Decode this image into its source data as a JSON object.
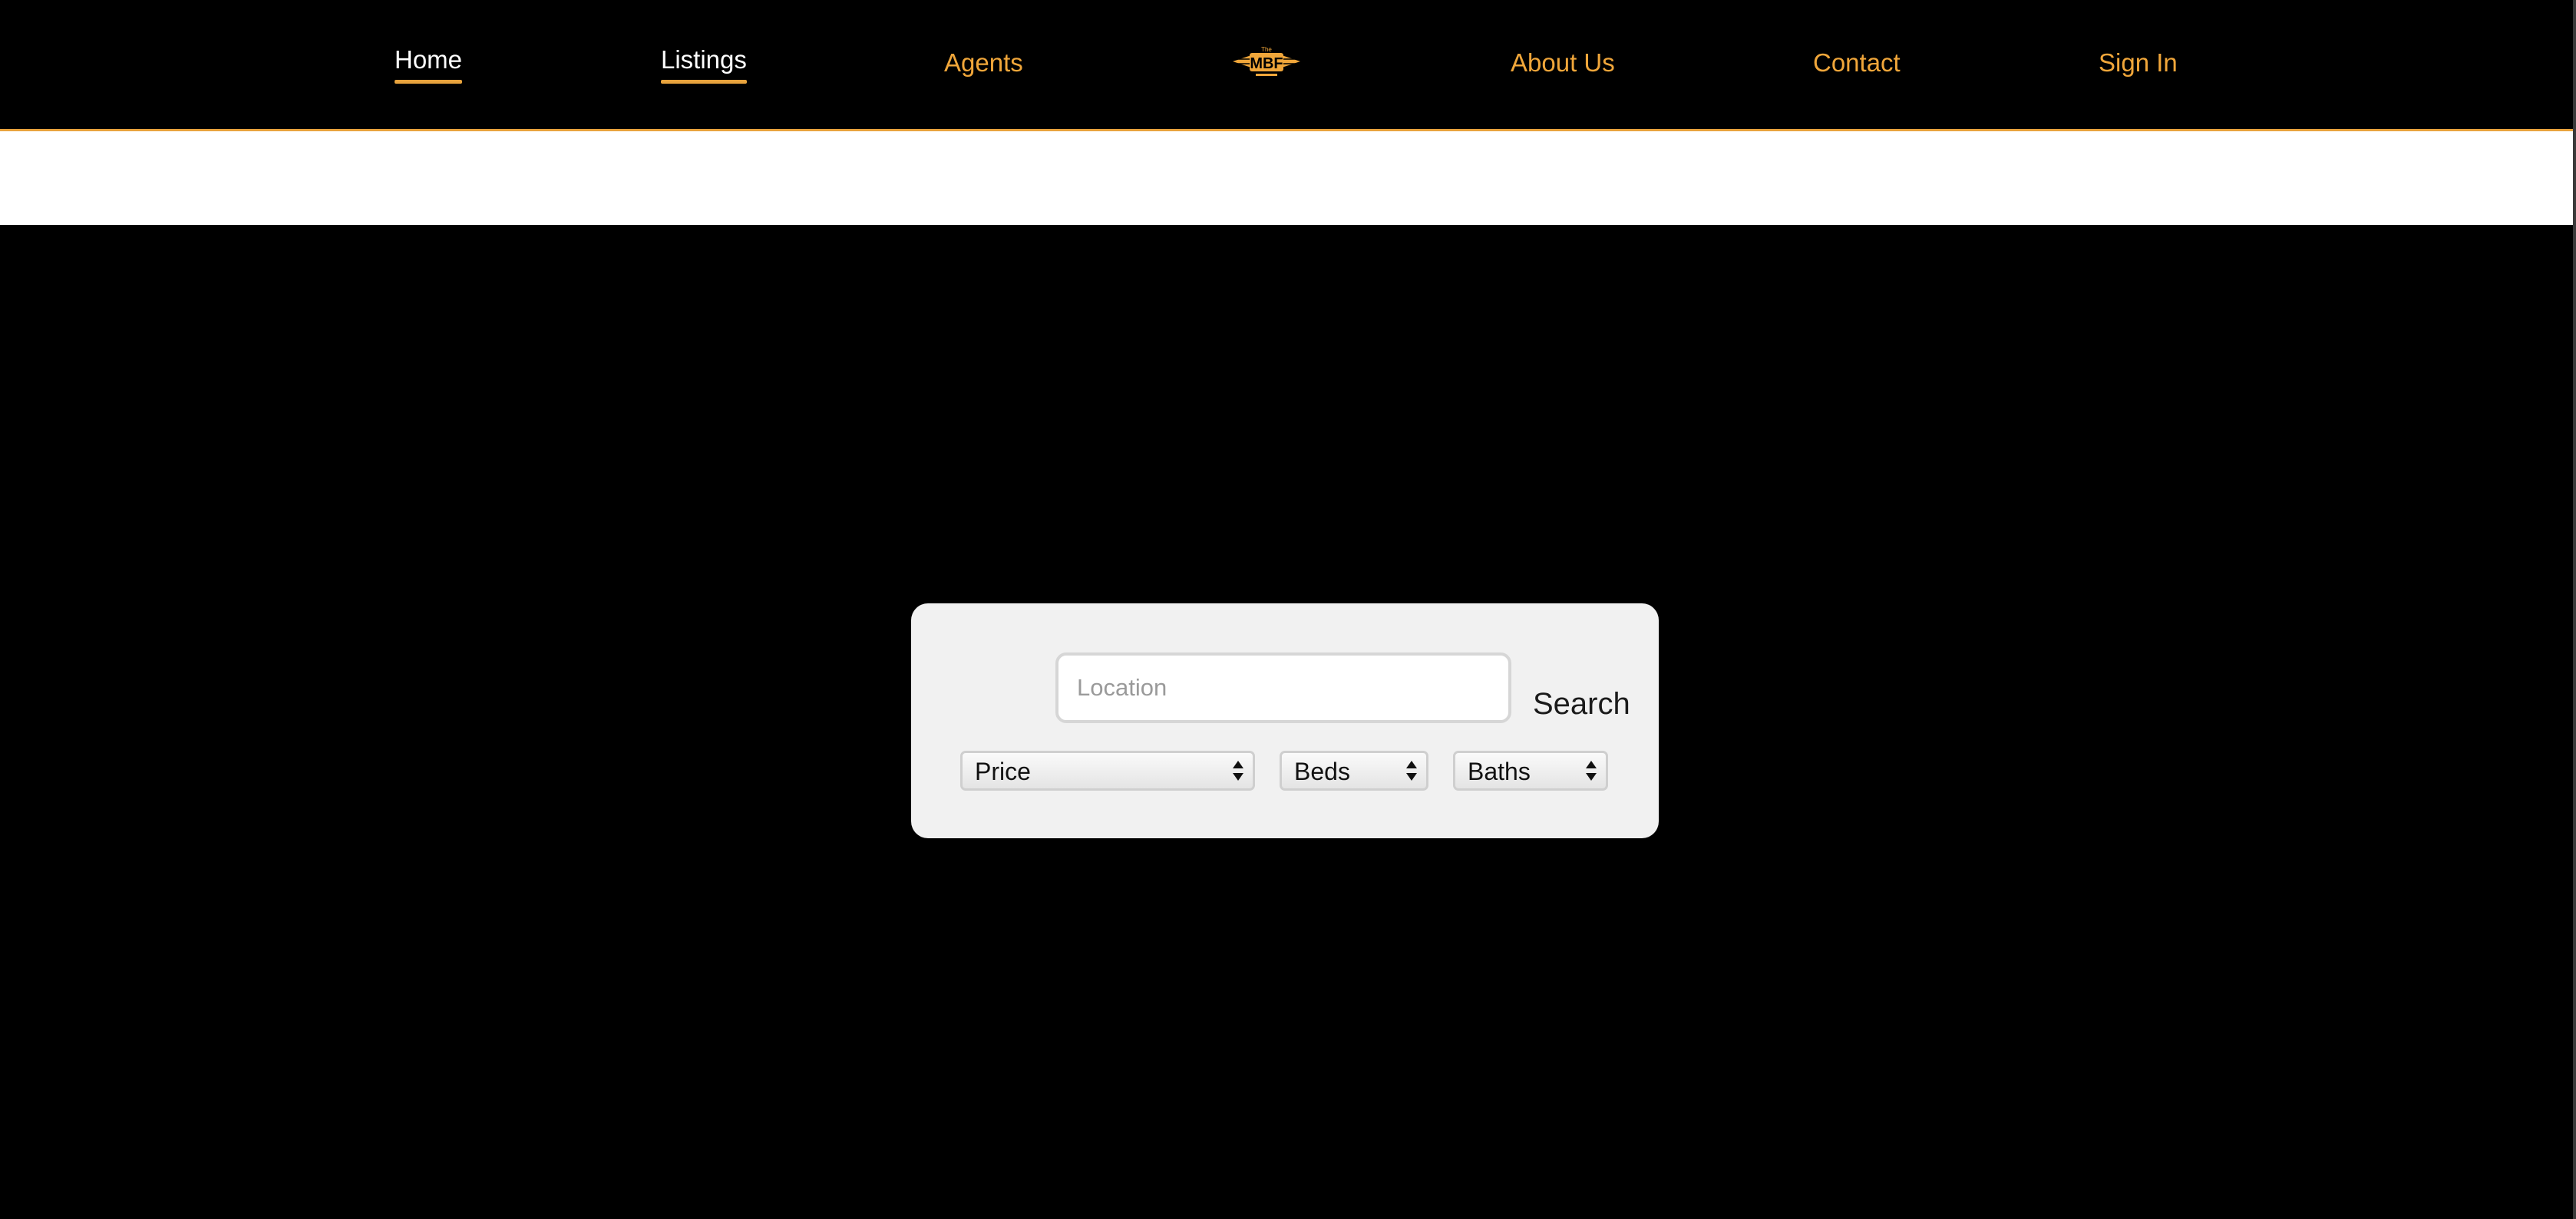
{
  "nav": {
    "items": [
      {
        "label": "Home",
        "active": true
      },
      {
        "label": "Listings",
        "active": true
      },
      {
        "label": "Agents",
        "active": false
      },
      {
        "label": "About Us",
        "active": false
      },
      {
        "label": "Contact",
        "active": false
      },
      {
        "label": "Sign In",
        "active": false
      }
    ],
    "logo": {
      "small_text": "The",
      "text": "MBF",
      "icon": "winged-logo-icon"
    }
  },
  "search": {
    "location_placeholder": "Location",
    "location_value": "",
    "button_label": "Search",
    "filters": {
      "price": "Price",
      "beds": "Beds",
      "baths": "Baths"
    }
  },
  "colors": {
    "background": "#000000",
    "accent": "#f0a63a",
    "active_link": "#ffffff",
    "card": "#f1f1f1",
    "band": "#ffffff"
  }
}
